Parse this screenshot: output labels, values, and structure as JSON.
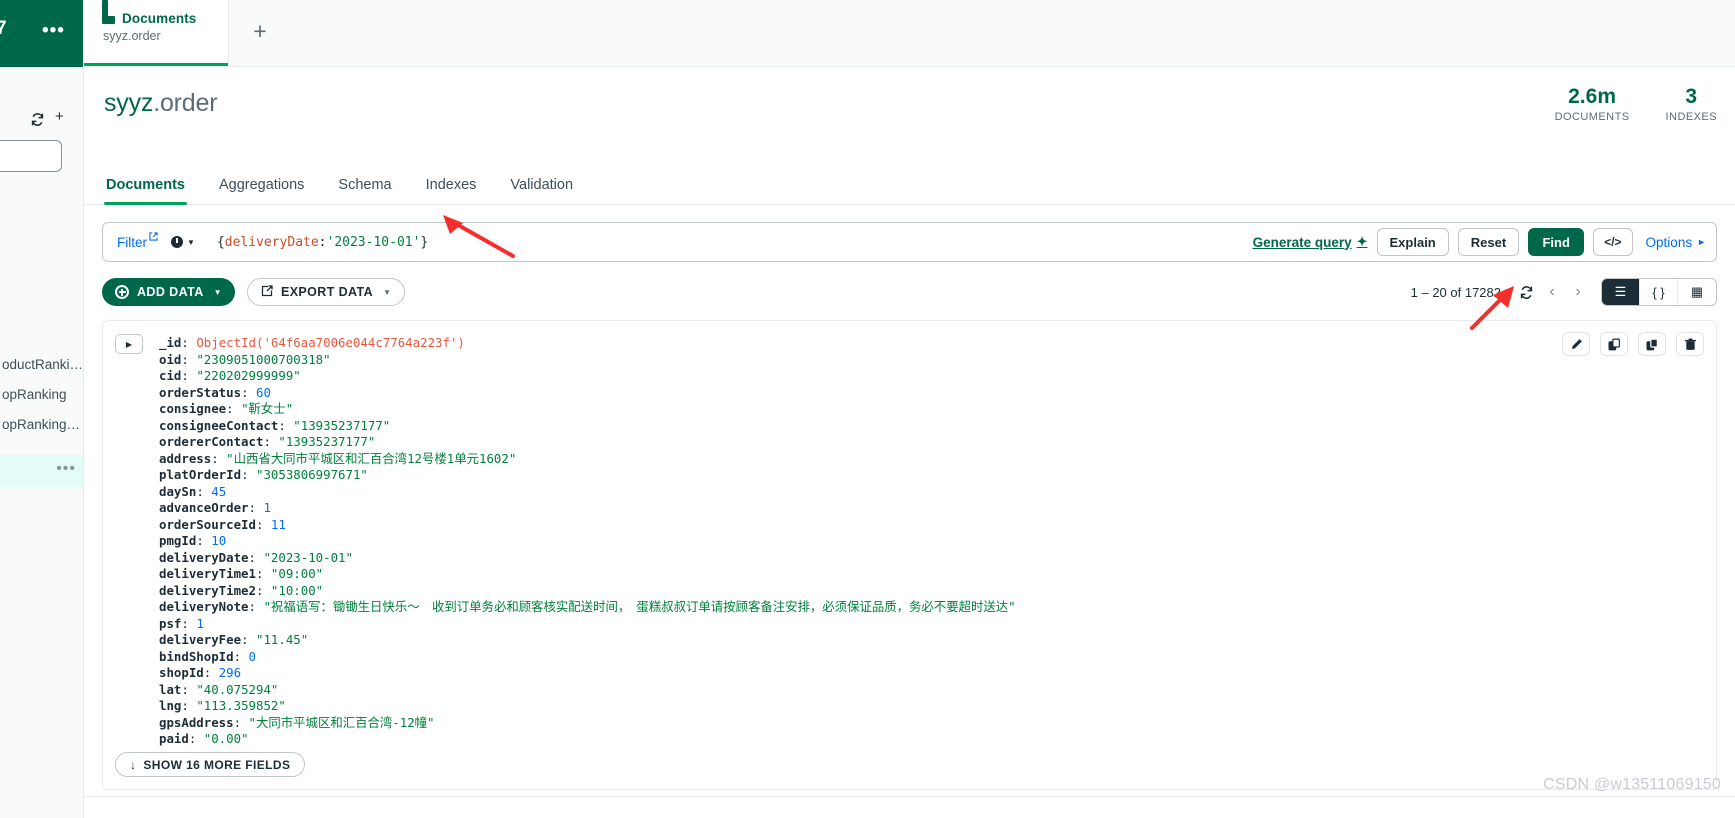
{
  "sidebar": {
    "badge_number": "7",
    "overflow_dots": "•••",
    "refresh_icon": "refresh-icon",
    "plus_icon": "plus-icon",
    "items": [
      {
        "label": "oductRanki…"
      },
      {
        "label": "opRanking"
      },
      {
        "label": "opRanking…"
      }
    ],
    "selected_row_dots": "•••"
  },
  "tabstrip": {
    "tab_title": "Documents",
    "tab_subtitle": "syyz.order",
    "folder_icon": "folder-icon",
    "new_tab_label": "+"
  },
  "collection": {
    "namespace_db": "syyz",
    "namespace_sep": ".",
    "namespace_coll": "order",
    "stats": [
      {
        "value": "2.6m",
        "label": "DOCUMENTS"
      },
      {
        "value": "3",
        "label": "INDEXES"
      }
    ]
  },
  "tabs": [
    {
      "label": "Documents",
      "active": true
    },
    {
      "label": "Aggregations",
      "active": false
    },
    {
      "label": "Schema",
      "active": false
    },
    {
      "label": "Indexes",
      "active": false
    },
    {
      "label": "Validation",
      "active": false
    }
  ],
  "querybar": {
    "filter_label": "Filter",
    "external_link_icon": "external-link-icon",
    "history_icon": "clock-icon",
    "history_caret_icon": "chevron-down-icon",
    "query_open_brace": "{",
    "query_key": "deliveryDate",
    "query_colon": ":",
    "query_value": "'2023-10-01'",
    "query_close_brace": "}",
    "generate_query_label": "Generate query",
    "sparkle_icon": "sparkle-icon",
    "explain_label": "Explain",
    "reset_label": "Reset",
    "find_label": "Find",
    "code_button_label": "</>",
    "options_label": "Options",
    "options_caret_icon": "triangle-right-icon"
  },
  "toolbar": {
    "add_data_label": "ADD DATA",
    "add_data_icon": "plus-circle-icon",
    "add_data_caret_icon": "chevron-down-icon",
    "export_data_label": "EXPORT DATA",
    "export_data_icon": "export-icon",
    "export_data_caret_icon": "chevron-down-icon",
    "result_count": "1 – 20 of 17282",
    "refresh_icon": "refresh-icon",
    "prev_icon": "chevron-left-icon",
    "next_icon": "chevron-right-icon",
    "view_list_icon": "list-view-icon",
    "view_json_icon": "json-view-icon",
    "view_table_icon": "table-view-icon"
  },
  "document": {
    "expand_icon": "caret-right-icon",
    "actions": [
      {
        "name": "edit-document-icon"
      },
      {
        "name": "clone-document-icon"
      },
      {
        "name": "copy-document-icon"
      },
      {
        "name": "delete-document-icon"
      }
    ],
    "fields": [
      {
        "key": "_id",
        "value": "ObjectId('64f6aa7006e044c7764a223f')",
        "type": "oid"
      },
      {
        "key": "oid",
        "value": "\"2309051000700318\"",
        "type": "str"
      },
      {
        "key": "cid",
        "value": "\"220202999999\"",
        "type": "str"
      },
      {
        "key": "orderStatus",
        "value": "60",
        "type": "num"
      },
      {
        "key": "consignee",
        "value": "\"靳女士\"",
        "type": "str"
      },
      {
        "key": "consigneeContact",
        "value": "\"13935237177\"",
        "type": "str"
      },
      {
        "key": "ordererContact",
        "value": "\"13935237177\"",
        "type": "str"
      },
      {
        "key": "address",
        "value": "\"山西省大同市平城区和汇百合湾12号楼1单元1602\"",
        "type": "str"
      },
      {
        "key": "platOrderId",
        "value": "\"3053806997671\"",
        "type": "str"
      },
      {
        "key": "daySn",
        "value": "45",
        "type": "num"
      },
      {
        "key": "advanceOrder",
        "value": "1",
        "type": "num"
      },
      {
        "key": "orderSourceId",
        "value": "11",
        "type": "num"
      },
      {
        "key": "pmgId",
        "value": "10",
        "type": "num"
      },
      {
        "key": "deliveryDate",
        "value": "\"2023-10-01\"",
        "type": "str"
      },
      {
        "key": "deliveryTime1",
        "value": "\"09:00\"",
        "type": "str"
      },
      {
        "key": "deliveryTime2",
        "value": "\"10:00\"",
        "type": "str"
      },
      {
        "key": "deliveryNote",
        "value": "\"祝福语写：锄锄生日快乐～　收到订单务必和顾客核实配送时间，　蛋糕叔叔订单请按顾客备注安排，必须保证品质，务必不要超时送达\"",
        "type": "str"
      },
      {
        "key": "psf",
        "value": "1",
        "type": "num"
      },
      {
        "key": "deliveryFee",
        "value": "\"11.45\"",
        "type": "str"
      },
      {
        "key": "bindShopId",
        "value": "0",
        "type": "num"
      },
      {
        "key": "shopId",
        "value": "296",
        "type": "num"
      },
      {
        "key": "lat",
        "value": "\"40.075294\"",
        "type": "str"
      },
      {
        "key": "lng",
        "value": "\"113.359852\"",
        "type": "str"
      },
      {
        "key": "gpsAddress",
        "value": "\"大同市平城区和汇百合湾-12幢\"",
        "type": "str"
      },
      {
        "key": "paid",
        "value": "\"0.00\"",
        "type": "str"
      }
    ],
    "show_more_label": "SHOW 16 MORE FIELDS",
    "show_more_icon": "arrow-down-icon"
  },
  "watermark": "CSDN @w13511069150",
  "colors": {
    "brand_green": "#00684a",
    "accent_green": "#00a35c",
    "link_blue": "#016bf8",
    "string_green": "#00803d",
    "number_blue": "#016bf8",
    "objectid_red": "#e8573f",
    "annotation_red": "#f42d2d"
  }
}
